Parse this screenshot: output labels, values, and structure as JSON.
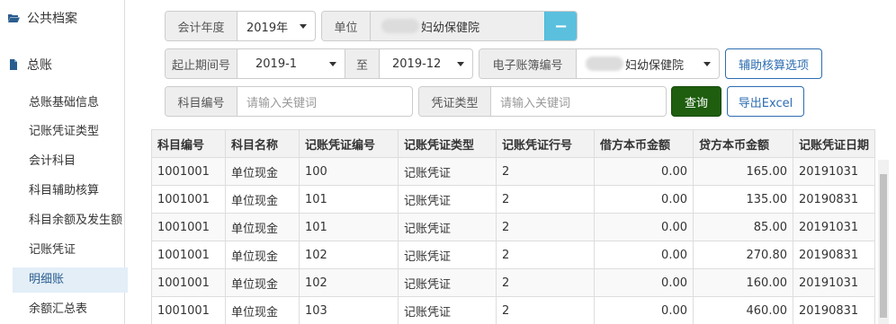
{
  "sidebar": {
    "archive_label": "公共档案",
    "ledger_label": "总账",
    "items": [
      {
        "label": "总账基础信息"
      },
      {
        "label": "记账凭证类型"
      },
      {
        "label": "会计科目"
      },
      {
        "label": "科目辅助核算"
      },
      {
        "label": "科目余额及发生额"
      },
      {
        "label": "记账凭证"
      },
      {
        "label": "明细账"
      },
      {
        "label": "余额汇总表"
      }
    ],
    "active_index": 6
  },
  "filters": {
    "fiscal_year_label": "会计年度",
    "fiscal_year_value": "2019年",
    "unit_label": "单位",
    "unit_value": "妇幼保健院",
    "minus_label": "−",
    "period_label": "起止期间号",
    "period_start": "2019-1",
    "period_to": "至",
    "period_end": "2019-12",
    "ledger_no_label": "电子账簿编号",
    "ledger_no_value": "妇幼保健院",
    "aux_button": "辅助核算选项",
    "subject_code_label": "科目编号",
    "subject_code_placeholder": "请输入关键词",
    "voucher_type_label": "凭证类型",
    "voucher_type_placeholder": "请输入关键词",
    "query_button": "查询",
    "export_button": "导出Excel"
  },
  "table": {
    "headers": [
      "科目编号",
      "科目名称",
      "记账凭证编号",
      "记账凭证类型",
      "记账凭证行号",
      "借方本币金额",
      "贷方本币金额",
      "记账凭证日期"
    ],
    "rows": [
      [
        "1001001",
        "单位现金",
        "100",
        "记账凭证",
        "2",
        "0.00",
        "165.00",
        "20191031"
      ],
      [
        "1001001",
        "单位现金",
        "101",
        "记账凭证",
        "2",
        "0.00",
        "135.00",
        "20190831"
      ],
      [
        "1001001",
        "单位现金",
        "101",
        "记账凭证",
        "2",
        "0.00",
        "85.00",
        "20191031"
      ],
      [
        "1001001",
        "单位现金",
        "102",
        "记账凭证",
        "2",
        "0.00",
        "270.80",
        "20190831"
      ],
      [
        "1001001",
        "单位现金",
        "102",
        "记账凭证",
        "2",
        "0.00",
        "160.00",
        "20191031"
      ],
      [
        "1001001",
        "单位现金",
        "103",
        "记账凭证",
        "2",
        "0.00",
        "460.00",
        "20190831"
      ]
    ]
  },
  "colors": {
    "query_bg": "#1e5e0e",
    "accent_blue": "#2d6db1",
    "minus_bg": "#5bc0de",
    "active_item_bg": "#e3eef7"
  }
}
